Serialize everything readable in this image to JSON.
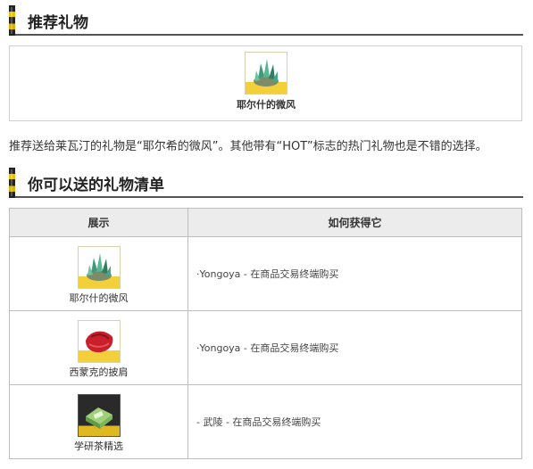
{
  "section1": {
    "title": "推荐礼物"
  },
  "recommended": {
    "name": "耶尔什的微风"
  },
  "description": "推荐送给莱瓦汀的礼物是“耶尔希的微风”。其他带有“HOT”标志的热门礼物也是不错的选择。",
  "section2": {
    "title": "你可以送的礼物清单"
  },
  "table": {
    "headers": {
      "show": "展示",
      "how": "如何获得它"
    },
    "rows": [
      {
        "name": "耶尔什的微风",
        "how": "·Yongoya - 在商品交易终端购买",
        "icon": "green-crystal-icon"
      },
      {
        "name": "西蒙克的披肩",
        "how": "·Yongoya - 在商品交易终端购买",
        "icon": "red-shawl-icon"
      },
      {
        "name": "学研茶精选",
        "how": "- 武陵 - 在商品交易终端购买",
        "icon": "tea-box-icon"
      }
    ]
  }
}
